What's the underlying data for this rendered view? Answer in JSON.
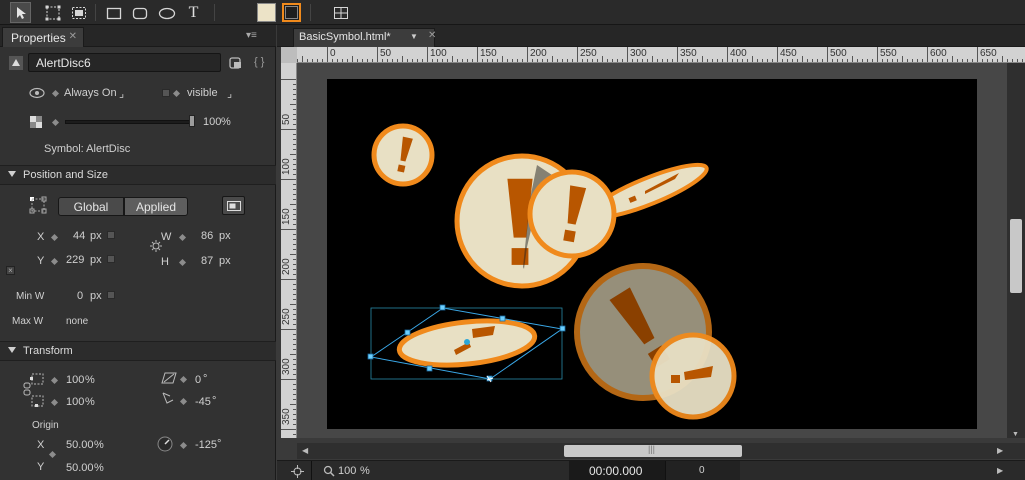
{
  "toolbar": {
    "tools": [
      {
        "name": "selection-tool",
        "active": true
      },
      {
        "name": "transform-tool"
      },
      {
        "name": "clipping-tool"
      },
      {
        "name": "rectangle-tool"
      },
      {
        "name": "rounded-rectangle-tool"
      },
      {
        "name": "ellipse-tool"
      },
      {
        "name": "text-tool",
        "glyph": "T"
      }
    ],
    "fill_color": "#ece3c7",
    "stroke_color": "#f08a1c"
  },
  "properties": {
    "tab_label": "Properties",
    "element_name": "AlertDisc6",
    "always_on_label": "Always On",
    "visible_label": "visible",
    "opacity_value": "100",
    "opacity_unit": "%",
    "symbol_label": "Symbol: AlertDisc",
    "position_size_title": "Position and Size",
    "global_label": "Global",
    "applied_label": "Applied",
    "x_label": "X",
    "x_value": "44",
    "y_label": "Y",
    "y_value": "229",
    "w_label": "W",
    "w_value": "86",
    "h_label": "H",
    "h_value": "87",
    "px": "px",
    "min_w_label": "Min W",
    "min_w_value": "0",
    "max_w_label": "Max W",
    "max_w_value": "none",
    "transform_title": "Transform",
    "scale_x": "100",
    "scale_y": "100",
    "percent": "%",
    "skew_value": "0",
    "degree": "°",
    "rotate_value": "-45",
    "origin_label": "Origin",
    "origin_x_label": "X",
    "origin_x": "50.00",
    "origin_y_label": "Y",
    "origin_y": "50.00",
    "angle_value": "-125"
  },
  "document": {
    "tab_label": "BasicSymbol.html*",
    "ruler_top_ticks": [
      "0",
      "50",
      "100",
      "150",
      "200",
      "250",
      "300",
      "350",
      "400",
      "450",
      "500",
      "550",
      "600",
      "650"
    ],
    "ruler_left_ticks": [
      "50",
      "100",
      "150",
      "200",
      "250",
      "300",
      "350"
    ],
    "zoom_value": "100",
    "zoom_unit": "%",
    "time_display": "00:00.000",
    "frame_value": "0"
  },
  "colors": {
    "stage": "#000000",
    "accent": "#e8952e",
    "disc_fill": "#e8e0c4",
    "disc_stroke": "#f08a1c",
    "exclaim": "#b85600"
  }
}
